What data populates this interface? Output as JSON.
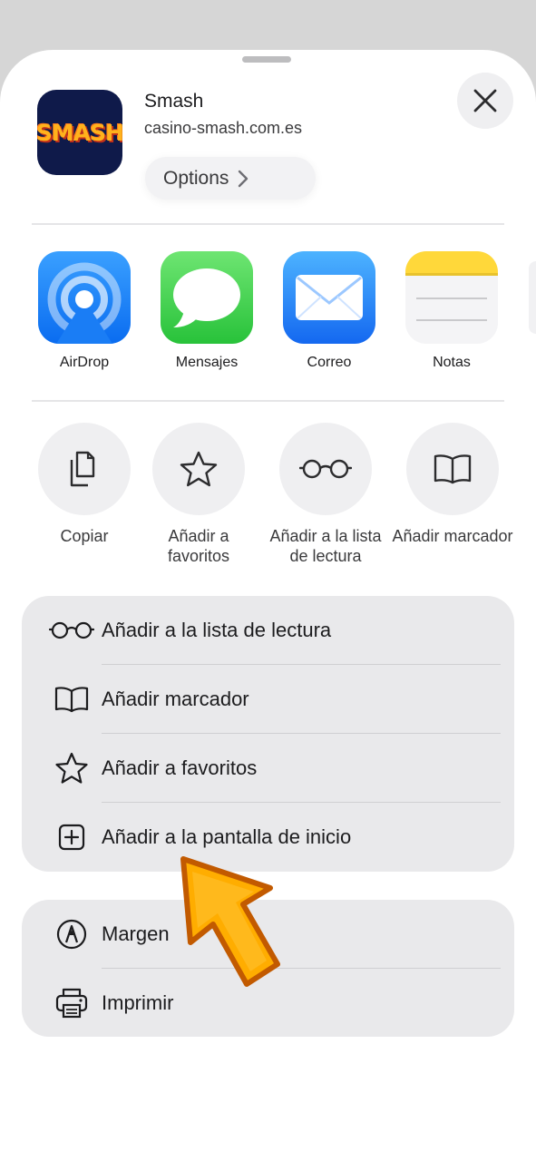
{
  "header": {
    "site_name": "Smash",
    "site_url": "casino-smash.com.es",
    "app_icon_text": "SMASH",
    "options_label": "Options"
  },
  "share_apps": [
    {
      "label": "AirDrop",
      "icon": "airdrop-icon"
    },
    {
      "label": "Mensajes",
      "icon": "messages-icon"
    },
    {
      "label": "Correo",
      "icon": "mail-icon"
    },
    {
      "label": "Notas",
      "icon": "notes-icon"
    }
  ],
  "quick_actions": [
    {
      "label": "Copiar",
      "icon": "copy-icon"
    },
    {
      "label": "Añadir a favoritos",
      "icon": "star-icon"
    },
    {
      "label": "Añadir a la lista de lectura",
      "icon": "glasses-icon"
    },
    {
      "label": "Añadir marcador",
      "icon": "book-icon"
    }
  ],
  "menu_group_1": [
    {
      "label": "Añadir a la lista de lectura",
      "icon": "glasses-icon"
    },
    {
      "label": "Añadir marcador",
      "icon": "book-icon"
    },
    {
      "label": "Añadir a favoritos",
      "icon": "star-icon"
    },
    {
      "label": "Añadir a la pantalla de inicio",
      "icon": "plus-square-icon"
    }
  ],
  "menu_group_2": [
    {
      "label": "Margen",
      "icon": "markup-icon"
    },
    {
      "label": "Imprimir",
      "icon": "printer-icon"
    }
  ],
  "colors": {
    "sheet": "#ffffff",
    "group_bg": "#e9e9eb",
    "arrow_fill": "#ffad00",
    "arrow_stroke": "#c25a00"
  }
}
